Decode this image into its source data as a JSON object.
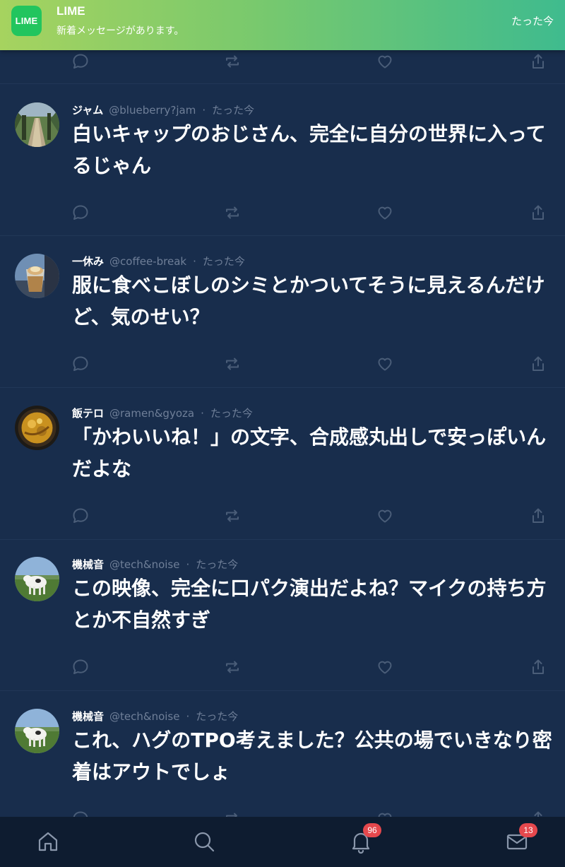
{
  "notification": {
    "app_icon_text": "LIME",
    "app_name": "LIME",
    "message": "新着メッセージがあります。",
    "time": "たった今"
  },
  "posts": [
    {
      "name": "ジャム",
      "handle": "@blueberry?jam",
      "time": "たった今",
      "text": "白いキャップのおじさん、完全に自分の世界に入ってるじゃん",
      "avatar": "forest-boardwalk"
    },
    {
      "name": "一休み",
      "handle": "@coffee-break",
      "time": "たった今",
      "text": "服に食べこぼしのシミとかついてそうに見えるんだけど、気のせい？",
      "avatar": "iced-coffee"
    },
    {
      "name": "飯テロ",
      "handle": "@ramen&gyoza",
      "time": "たった今",
      "text": "「かわいいね！」の文字、合成感丸出しで安っぽいんだよな",
      "avatar": "ramen-bowl"
    },
    {
      "name": "機械音",
      "handle": "@tech&noise",
      "time": "たった今",
      "text": "この映像、完全に口パク演出だよね？マイクの持ち方とか不自然すぎ",
      "avatar": "cow-field"
    },
    {
      "name": "機械音",
      "handle": "@tech&noise",
      "time": "たった今",
      "text": "これ、ハグのTPO考えました？公共の場でいきなり密着はアウトでしょ",
      "avatar": "cow-field"
    }
  ],
  "icons": {
    "reply": "reply-icon",
    "repost": "repost-icon",
    "like": "like-icon",
    "share": "share-icon"
  },
  "bottom_nav": {
    "notifications_badge": "96",
    "messages_badge": "13"
  },
  "colors": {
    "background": "#182d4c",
    "bottom_nav": "#0e1c30",
    "badge": "#e5484d",
    "banner_start": "#a6d35f",
    "banner_end": "#3fbb8e"
  }
}
